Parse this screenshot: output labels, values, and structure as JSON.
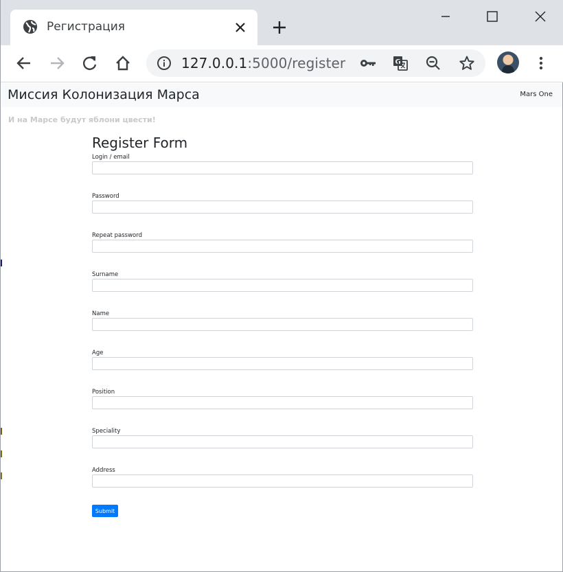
{
  "browser": {
    "tab_title": "Регистрация",
    "url_host": "127.0.0.1",
    "url_rest": ":5000/register"
  },
  "navbar": {
    "brand": "Миссия Колонизация Марса",
    "link": "Mars One"
  },
  "tagline": "И на Марсе будут яблони цвести!",
  "form": {
    "title": "Register Form",
    "fields": [
      {
        "label": "Login / email",
        "value": ""
      },
      {
        "label": "Password",
        "value": ""
      },
      {
        "label": "Repeat password",
        "value": ""
      },
      {
        "label": "Surname",
        "value": ""
      },
      {
        "label": "Name",
        "value": ""
      },
      {
        "label": "Age",
        "value": ""
      },
      {
        "label": "Position",
        "value": ""
      },
      {
        "label": "Speciality",
        "value": ""
      },
      {
        "label": "Address",
        "value": ""
      }
    ],
    "submit_label": "Submit"
  },
  "colors": {
    "primary": "#007bff",
    "navbar_bg": "#f8f9fa",
    "tab_strip": "#dee1e6"
  }
}
